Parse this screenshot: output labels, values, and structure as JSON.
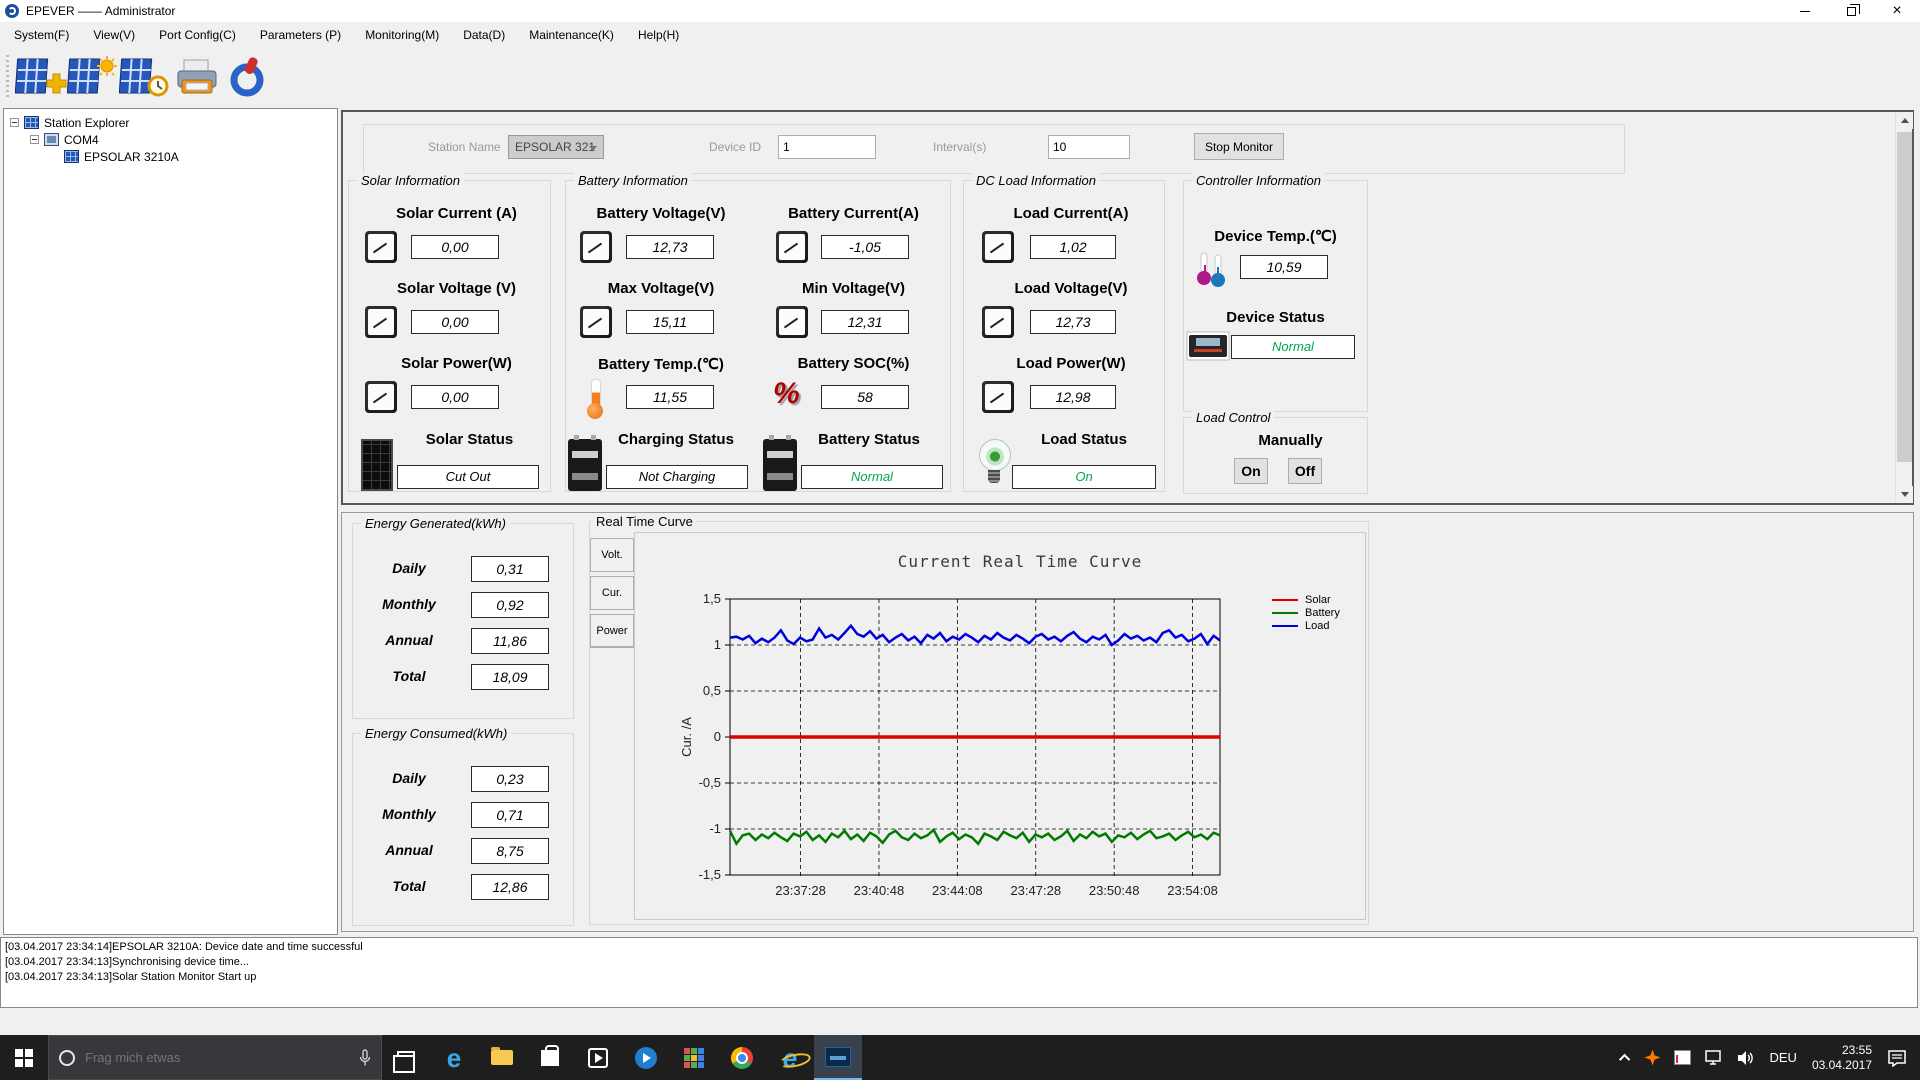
{
  "window": {
    "title": "EPEVER —— Administrator"
  },
  "menu": {
    "items": [
      "System(F)",
      "View(V)",
      "Port Config(C)",
      "Parameters (P)",
      "Monitoring(M)",
      "Data(D)",
      "Maintenance(K)",
      "Help(H)"
    ]
  },
  "tree": {
    "root": "Station Explorer",
    "com": "COM4",
    "device": "EPSOLAR 3210A"
  },
  "station_bar": {
    "station_name_label": "Station Name",
    "station_name_value": "EPSOLAR 321",
    "device_id_label": "Device ID",
    "device_id_value": "1",
    "interval_label": "Interval(s)",
    "interval_value": "10",
    "stop_monitor": "Stop Monitor"
  },
  "solar": {
    "title": "Solar Information",
    "current_label": "Solar Current (A)",
    "current_value": "0,00",
    "voltage_label": "Solar Voltage (V)",
    "voltage_value": "0,00",
    "power_label": "Solar Power(W)",
    "power_value": "0,00",
    "status_label": "Solar Status",
    "status_value": "Cut Out"
  },
  "battery": {
    "title": "Battery Information",
    "voltage_label": "Battery Voltage(V)",
    "voltage_value": "12,73",
    "current_label": "Battery Current(A)",
    "current_value": "-1,05",
    "max_label": "Max Voltage(V)",
    "max_value": "15,11",
    "min_label": "Min Voltage(V)",
    "min_value": "12,31",
    "temp_label": "Battery Temp.(℃)",
    "temp_value": "11,55",
    "soc_label": "Battery SOC(%)",
    "soc_value": "58",
    "charging_label": "Charging Status",
    "charging_value": "Not Charging",
    "status_label": "Battery Status",
    "status_value": "Normal"
  },
  "dcload": {
    "title": "DC Load Information",
    "current_label": "Load Current(A)",
    "current_value": "1,02",
    "voltage_label": "Load Voltage(V)",
    "voltage_value": "12,73",
    "power_label": "Load Power(W)",
    "power_value": "12,98",
    "status_label": "Load Status",
    "status_value": "On"
  },
  "controller": {
    "title": "Controller Information",
    "temp_label": "Device Temp.(℃)",
    "temp_value": "10,59",
    "status_label": "Device Status",
    "status_value": "Normal"
  },
  "load_control": {
    "title": "Load Control",
    "manually_label": "Manually",
    "on_button": "On",
    "off_button": "Off"
  },
  "energy_generated": {
    "title": "Energy Generated(kWh)",
    "rows": [
      {
        "label": "Daily",
        "value": "0,31"
      },
      {
        "label": "Monthly",
        "value": "0,92"
      },
      {
        "label": "Annual",
        "value": "11,86"
      },
      {
        "label": "Total",
        "value": "18,09"
      }
    ]
  },
  "energy_consumed": {
    "title": "Energy Consumed(kWh)",
    "rows": [
      {
        "label": "Daily",
        "value": "0,23"
      },
      {
        "label": "Monthly",
        "value": "0,71"
      },
      {
        "label": "Annual",
        "value": "8,75"
      },
      {
        "label": "Total",
        "value": "12,86"
      }
    ]
  },
  "curve": {
    "title": "Real Time Curve",
    "tabs": [
      "Volt.",
      "Cur.",
      "Power"
    ]
  },
  "colors": {
    "status_green": "#00a651",
    "chart_solar": "#dd0000",
    "chart_battery": "#007a00",
    "chart_load": "#0000dd"
  },
  "chart_data": {
    "type": "line",
    "title": "Current Real Time Curve",
    "ylabel": "Cur. /A",
    "ylim": [
      -1.5,
      1.5
    ],
    "yticks": [
      1.5,
      1,
      0.5,
      0,
      -0.5,
      -1,
      -1.5
    ],
    "ytick_labels": [
      "1,5",
      "1",
      "0,5",
      "0",
      "-0,5",
      "-1",
      "-1,5"
    ],
    "xticks": [
      "23:37:28",
      "23:40:48",
      "23:44:08",
      "23:47:28",
      "23:50:48",
      "23:54:08"
    ],
    "grid": "dashed",
    "legend_position": "top-right",
    "series": [
      {
        "name": "Solar",
        "color": "#dd0000",
        "values": [
          0,
          0,
          0,
          0,
          0,
          0,
          0,
          0,
          0,
          0,
          0,
          0,
          0,
          0,
          0,
          0,
          0,
          0,
          0,
          0,
          0,
          0,
          0,
          0,
          0,
          0,
          0,
          0,
          0,
          0,
          0,
          0,
          0,
          0,
          0,
          0,
          0,
          0,
          0,
          0,
          0,
          0,
          0,
          0,
          0,
          0,
          0,
          0,
          0,
          0,
          0,
          0,
          0,
          0,
          0,
          0,
          0,
          0,
          0,
          0,
          0,
          0,
          0,
          0,
          0,
          0,
          0,
          0,
          0,
          0,
          0,
          0,
          0,
          0,
          0,
          0,
          0,
          0
        ]
      },
      {
        "name": "Battery",
        "color": "#007a00",
        "values": [
          -1.02,
          -1.16,
          -1.07,
          -1.05,
          -1.12,
          -1.06,
          -1.1,
          -1.04,
          -1.09,
          -1.13,
          -1.05,
          -1.08,
          -1.03,
          -1.12,
          -1.07,
          -1.14,
          -1.05,
          -1.09,
          -1.02,
          -1.11,
          -1.06,
          -1.13,
          -1.04,
          -1.08,
          -1.15,
          -1.06,
          -1.02,
          -1.09,
          -1.12,
          -1.05,
          -1.1,
          -1.07,
          -1.01,
          -1.14,
          -1.08,
          -1.04,
          -1.11,
          -1.06,
          -1.09,
          -1.16,
          -1.05,
          -1.08,
          -1.12,
          -1.03,
          -1.07,
          -1.1,
          -1.04,
          -1.14,
          -1.06,
          -1.09,
          -1.05,
          -1.12,
          -1.08,
          -1.02,
          -1.13,
          -1.06,
          -1.1,
          -1.03,
          -1.08,
          -1.05,
          -1.14,
          -1.07,
          -1.09,
          -1.04,
          -1.11,
          -1.06,
          -1.02,
          -1.1,
          -1.08,
          -1.05,
          -1.12,
          -1.07,
          -1.03,
          -1.09,
          -1.06,
          -1.11,
          -1.04,
          -1.07
        ]
      },
      {
        "name": "Load",
        "color": "#0000dd",
        "values": [
          1.08,
          1.09,
          1.06,
          1.1,
          1.02,
          1.07,
          1.03,
          1.08,
          1.16,
          1.05,
          1.01,
          1.08,
          1.04,
          1.06,
          1.18,
          1.08,
          1.11,
          1.06,
          1.13,
          1.21,
          1.12,
          1.09,
          1.15,
          1.07,
          1.11,
          1.03,
          1.08,
          1.12,
          1.05,
          1.09,
          1.02,
          1.11,
          1.07,
          1.13,
          1.04,
          1.09,
          1.06,
          1.12,
          1.08,
          1.03,
          1.1,
          1.06,
          1.13,
          1.08,
          1.05,
          1.11,
          1.07,
          1.02,
          1.09,
          1.12,
          1.06,
          1.09,
          1.04,
          1.1,
          1.14,
          1.07,
          1.03,
          1.09,
          1.06,
          1.11,
          1.0,
          1.05,
          1.12,
          1.07,
          1.1,
          1.05,
          1.08,
          1.03,
          1.13,
          1.16,
          1.08,
          1.11,
          1.04,
          1.07,
          1.12,
          1.01,
          1.1,
          1.05
        ]
      }
    ]
  },
  "log": {
    "lines": [
      "[03.04.2017 23:34:14]EPSOLAR 3210A: Device date and time successful",
      "[03.04.2017 23:34:13]Synchronising device time...",
      "[03.04.2017 23:34:13]Solar Station Monitor Start up"
    ]
  },
  "taskbar": {
    "search_placeholder": "Frag mich etwas",
    "language": "DEU",
    "time": "23:55",
    "date": "03.04.2017"
  }
}
